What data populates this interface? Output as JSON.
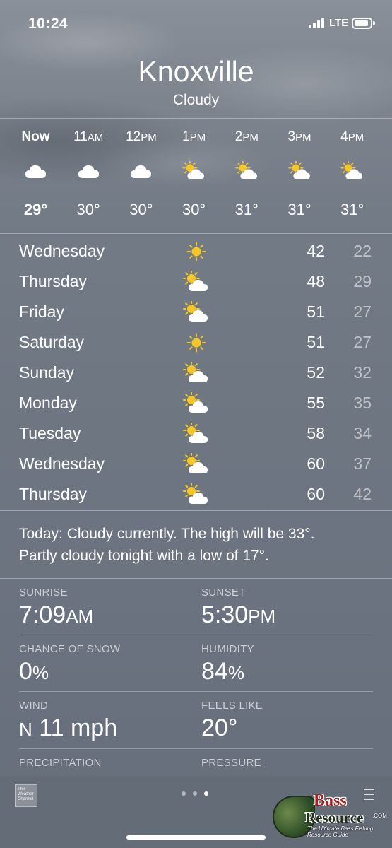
{
  "status_bar": {
    "time": "10:24",
    "network": "LTE"
  },
  "header": {
    "city": "Knoxville",
    "condition": "Cloudy"
  },
  "hourly": [
    {
      "label": "Now",
      "suffix": "",
      "icon": "cloud-icon",
      "temp": "29°"
    },
    {
      "label": "11",
      "suffix": "AM",
      "icon": "cloud-icon",
      "temp": "30°"
    },
    {
      "label": "12",
      "suffix": "PM",
      "icon": "cloud-icon",
      "temp": "30°"
    },
    {
      "label": "1",
      "suffix": "PM",
      "icon": "partly-sunny-icon",
      "temp": "30°"
    },
    {
      "label": "2",
      "suffix": "PM",
      "icon": "partly-sunny-icon",
      "temp": "31°"
    },
    {
      "label": "3",
      "suffix": "PM",
      "icon": "partly-sunny-icon",
      "temp": "31°"
    },
    {
      "label": "4",
      "suffix": "PM",
      "icon": "partly-sunny-icon",
      "temp": "31°"
    }
  ],
  "daily": [
    {
      "day": "Wednesday",
      "icon": "sun-icon",
      "high": "42",
      "low": "22"
    },
    {
      "day": "Thursday",
      "icon": "partly-sunny-icon",
      "high": "48",
      "low": "29"
    },
    {
      "day": "Friday",
      "icon": "partly-sunny-icon",
      "high": "51",
      "low": "27"
    },
    {
      "day": "Saturday",
      "icon": "sun-icon",
      "high": "51",
      "low": "27"
    },
    {
      "day": "Sunday",
      "icon": "partly-sunny-icon",
      "high": "52",
      "low": "32"
    },
    {
      "day": "Monday",
      "icon": "partly-sunny-icon",
      "high": "55",
      "low": "35"
    },
    {
      "day": "Tuesday",
      "icon": "partly-sunny-icon",
      "high": "58",
      "low": "34"
    },
    {
      "day": "Wednesday",
      "icon": "partly-sunny-icon",
      "high": "60",
      "low": "37"
    },
    {
      "day": "Thursday",
      "icon": "partly-sunny-icon",
      "high": "60",
      "low": "42"
    }
  ],
  "summary": {
    "line1": "Today: Cloudy currently. The high will be 33°.",
    "line2": "Partly cloudy tonight with a low of 17°."
  },
  "details": {
    "sunrise_label": "SUNRISE",
    "sunrise_value": "7:09",
    "sunrise_suffix": "AM",
    "sunset_label": "SUNSET",
    "sunset_value": "5:30",
    "sunset_suffix": "PM",
    "snow_label": "CHANCE OF SNOW",
    "snow_value": "0",
    "snow_suffix": "%",
    "humidity_label": "HUMIDITY",
    "humidity_value": "84",
    "humidity_suffix": "%",
    "wind_label": "WIND",
    "wind_dir": "N",
    "wind_value": " 11 mph",
    "feels_label": "FEELS LIKE",
    "feels_value": "20°",
    "precip_label": "PRECIPITATION",
    "pressure_label": "PRESSURE"
  },
  "footer": {
    "provider_line1": "The",
    "provider_line2": "Weather",
    "provider_line3": "Channel",
    "page_count": 3,
    "active_page": 3
  },
  "watermark": {
    "line1": "Bass",
    "line2": "Resource",
    "tagline": "The Ultimate Bass Fishing Resource Guide",
    "domain": ".COM"
  },
  "colors": {
    "sun": "#f6c624",
    "low_temp": "rgba(255,255,255,0.55)"
  }
}
